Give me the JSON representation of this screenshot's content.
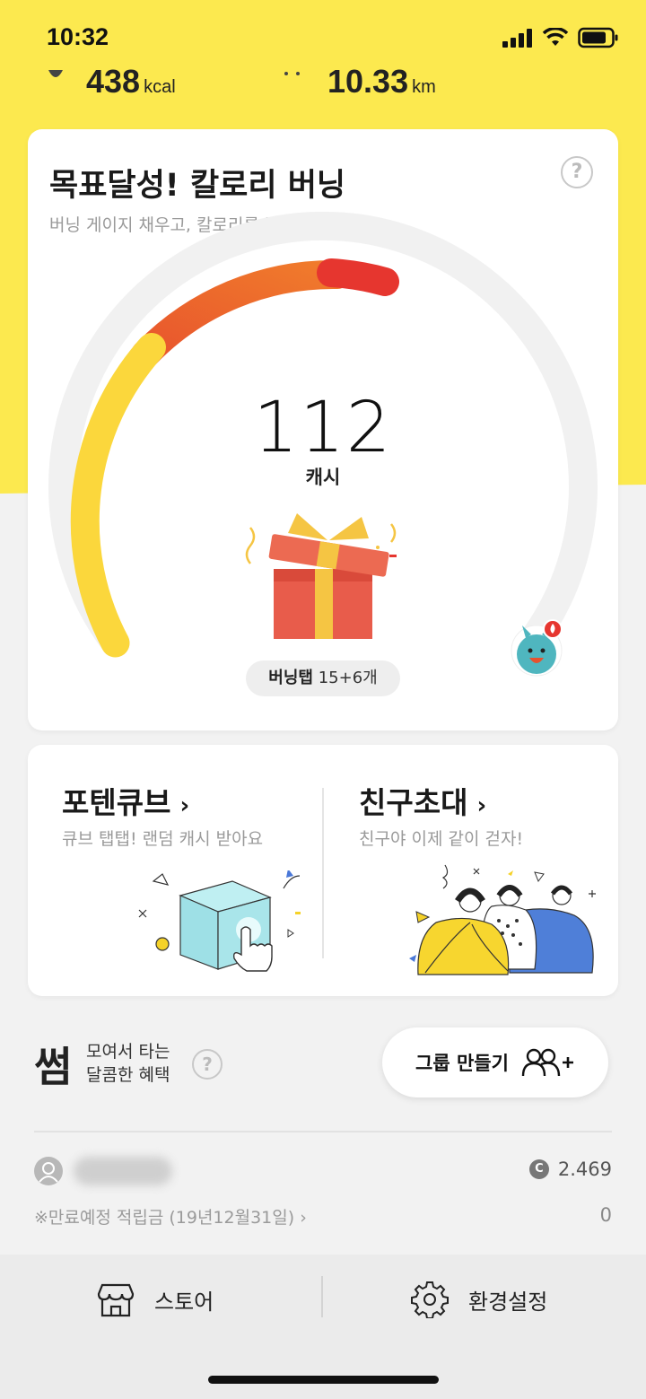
{
  "status_bar": {
    "time": "10:32"
  },
  "stats": {
    "calories_value": "438",
    "calories_unit": "kcal",
    "distance_value": "10.33",
    "distance_unit": "km"
  },
  "burning_card": {
    "title": "목표달성! 칼로리 버닝",
    "subtitle": "버닝 게이지 채우고, 칼로리를 날려보세요",
    "help": "?",
    "cash_value": "112",
    "cash_unit": "캐시",
    "burning_tap_label": "버닝탭",
    "burning_tap_count": "15+6개",
    "gauge_progress": 0.52,
    "colors": {
      "yellow": "#fbd73c",
      "orange": "#ee6b2d",
      "red": "#e6362f",
      "track": "#f1f1f1"
    }
  },
  "potencube": {
    "title": "포텐큐브",
    "chevron": "›",
    "subtitle": "큐브 탭탭! 랜덤 캐시 받아요"
  },
  "invite": {
    "title": "친구초대",
    "chevron": "›",
    "subtitle": "친구야 이제 같이 걷자!"
  },
  "ssum": {
    "logo": "썸",
    "line1": "모여서 타는",
    "line2": "달콤한 혜택",
    "help": "?",
    "group_button": "그룹 만들기"
  },
  "account": {
    "coin_symbol": "C",
    "balance": "2.469",
    "expire_label": "※만료예정 적립금 (19년12월31일) ›",
    "expire_value": "0"
  },
  "bottom_nav": {
    "store": "스토어",
    "settings": "환경설정"
  }
}
